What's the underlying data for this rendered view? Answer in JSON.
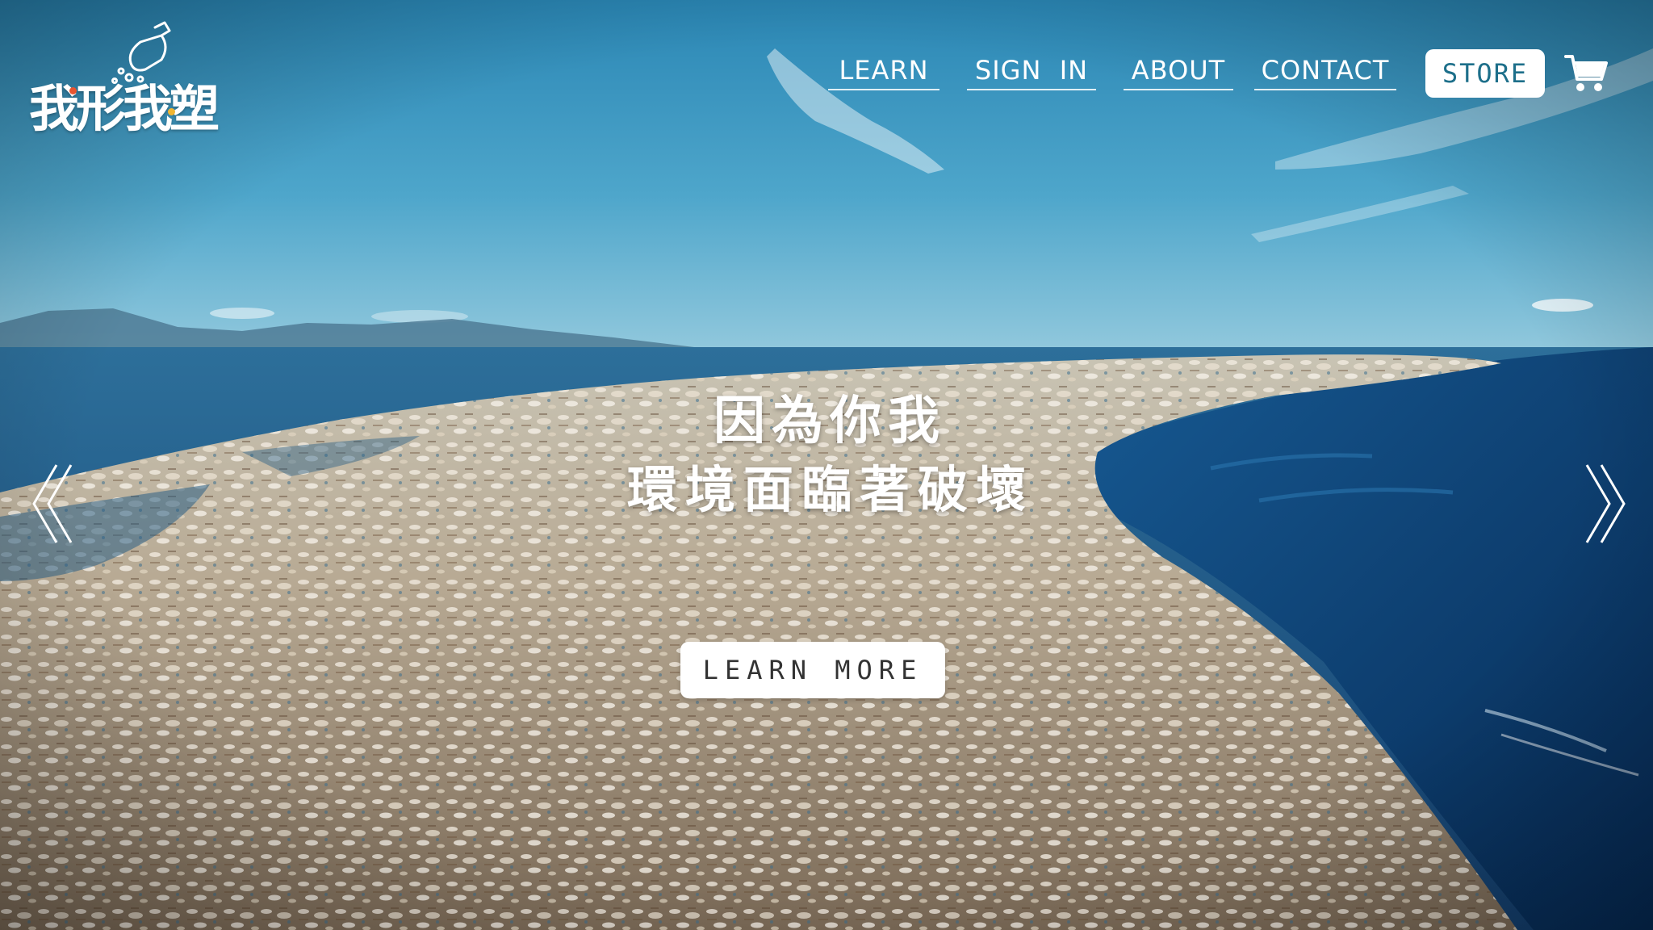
{
  "brand": {
    "logo_text": "我形我塑",
    "logo_icon": "bottle-bubbles-icon"
  },
  "nav": {
    "links": [
      {
        "label": "LEARN"
      },
      {
        "label": "SIGN  IN"
      },
      {
        "label": "ABOUT"
      },
      {
        "label": "CONTACT"
      }
    ],
    "store_label": "STORE",
    "cart_icon": "cart-icon"
  },
  "hero": {
    "headline_line1": "因為你我",
    "headline_line2": "環境面臨著破壞",
    "cta_label": "LEARN MORE",
    "prev_icon": "double-chevron-left-icon",
    "next_icon": "double-chevron-right-icon",
    "background": "ocean-plastic-pollution-photo"
  },
  "colors": {
    "sky_top": "#2a8fb8",
    "sky_horizon": "#8cc6dc",
    "sea": "#1f5f8f",
    "deep_sea": "#0b3a66",
    "debris": "#cbbfaa",
    "text": "#ffffff",
    "button_text": "#1d6f8a"
  }
}
